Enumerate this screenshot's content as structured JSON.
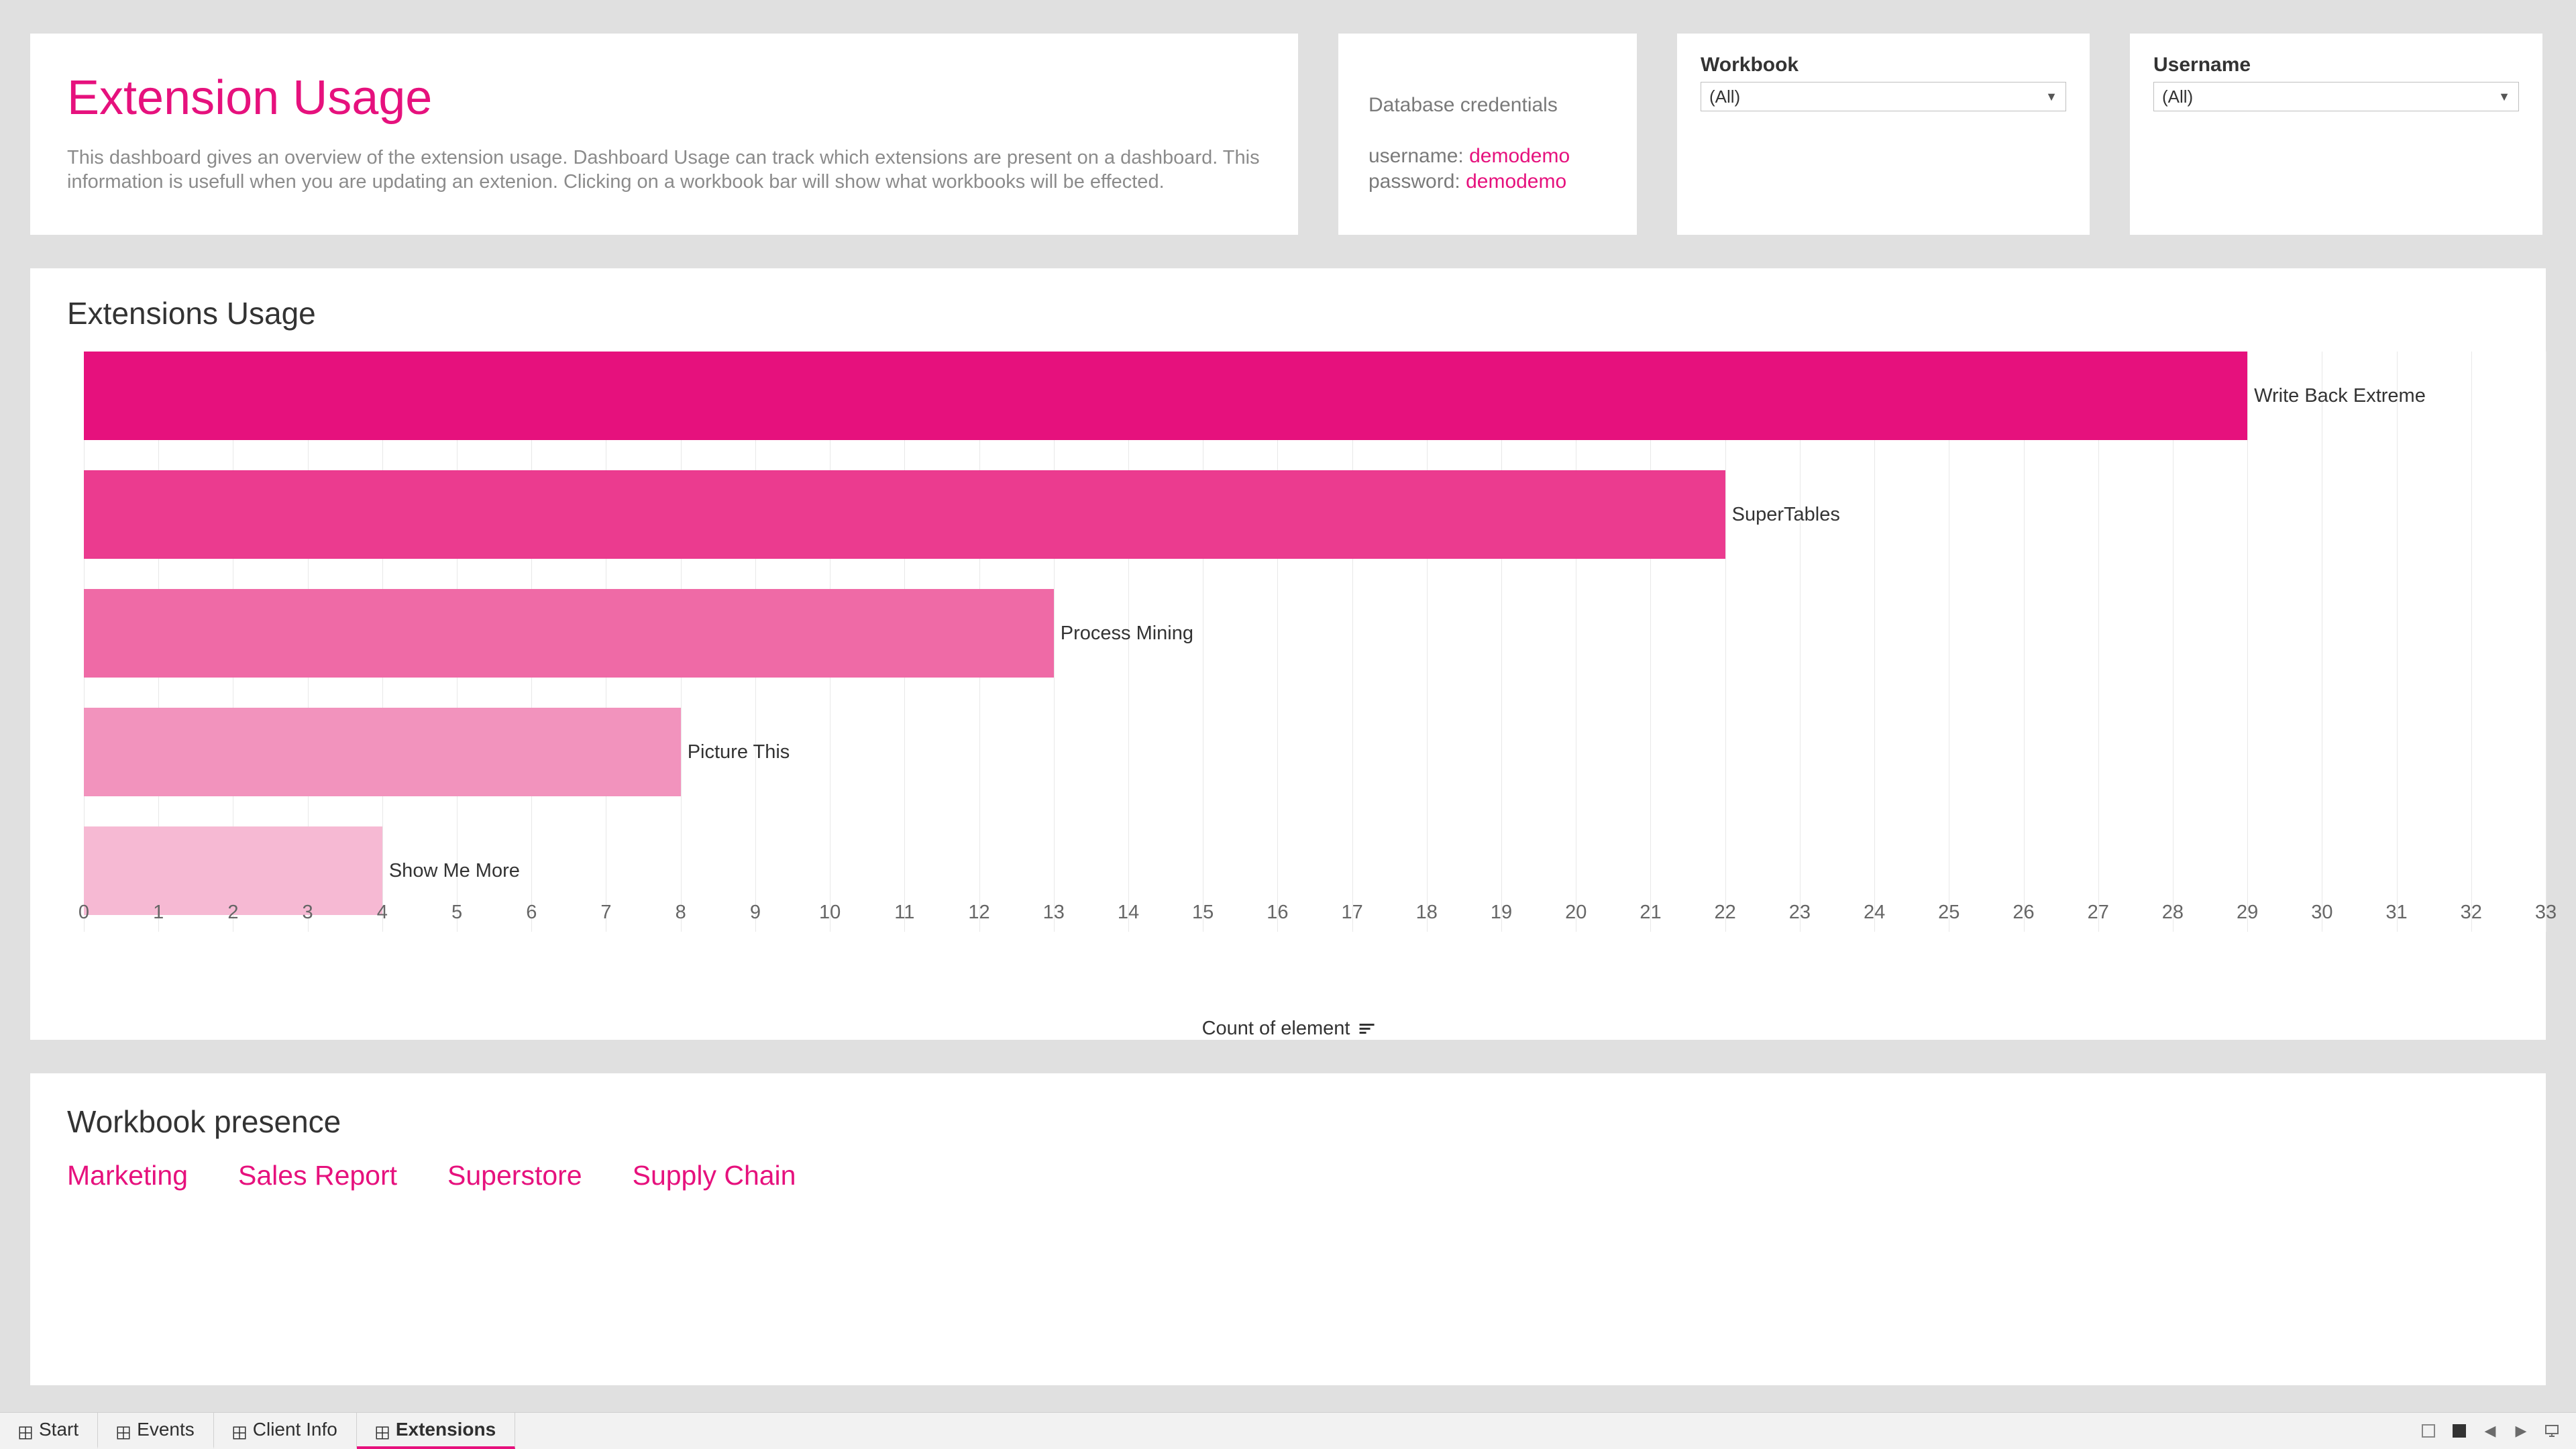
{
  "header": {
    "title": "Extension Usage",
    "description": "This dashboard gives an overview of the extension usage. Dashboard Usage can track which extensions are present on a dashboard. This information is usefull when you are updating an extenion. Clicking on a workbook bar will show what workbooks will be effected."
  },
  "db_credentials": {
    "heading": "Database credentials",
    "username_label": "username: ",
    "username_value": "demodemo",
    "password_label": "password: ",
    "password_value": "demodemo"
  },
  "filters": {
    "workbook": {
      "label": "Workbook",
      "value": "(All)"
    },
    "username": {
      "label": "Username",
      "value": "(All)"
    }
  },
  "chart": {
    "title": "Extensions Usage",
    "x_axis_label": "Count of element"
  },
  "chart_data": {
    "type": "bar",
    "orientation": "horizontal",
    "title": "Extensions Usage",
    "xlabel": "Count of element",
    "ylabel": "",
    "xlim": [
      0,
      33
    ],
    "x_ticks": [
      0,
      1,
      2,
      3,
      4,
      5,
      6,
      7,
      8,
      9,
      10,
      11,
      12,
      13,
      14,
      15,
      16,
      17,
      18,
      19,
      20,
      21,
      22,
      23,
      24,
      25,
      26,
      27,
      28,
      29,
      30,
      31,
      32,
      33
    ],
    "categories": [
      "Write Back Extreme",
      "SuperTables",
      "Process Mining",
      "Picture This",
      "Show Me More"
    ],
    "values": [
      29,
      22,
      13,
      8,
      4
    ],
    "colors": [
      "#e6117d",
      "#eb3b8f",
      "#ef6aa6",
      "#f293bd",
      "#f6b9d3"
    ]
  },
  "workbook_presence": {
    "title": "Workbook presence",
    "items": [
      "Marketing",
      "Sales Report",
      "Superstore",
      "Supply Chain"
    ]
  },
  "tabs": {
    "items": [
      {
        "label": "Start",
        "active": false
      },
      {
        "label": "Events",
        "active": false
      },
      {
        "label": "Client Info",
        "active": false
      },
      {
        "label": "Extensions",
        "active": true
      }
    ]
  }
}
